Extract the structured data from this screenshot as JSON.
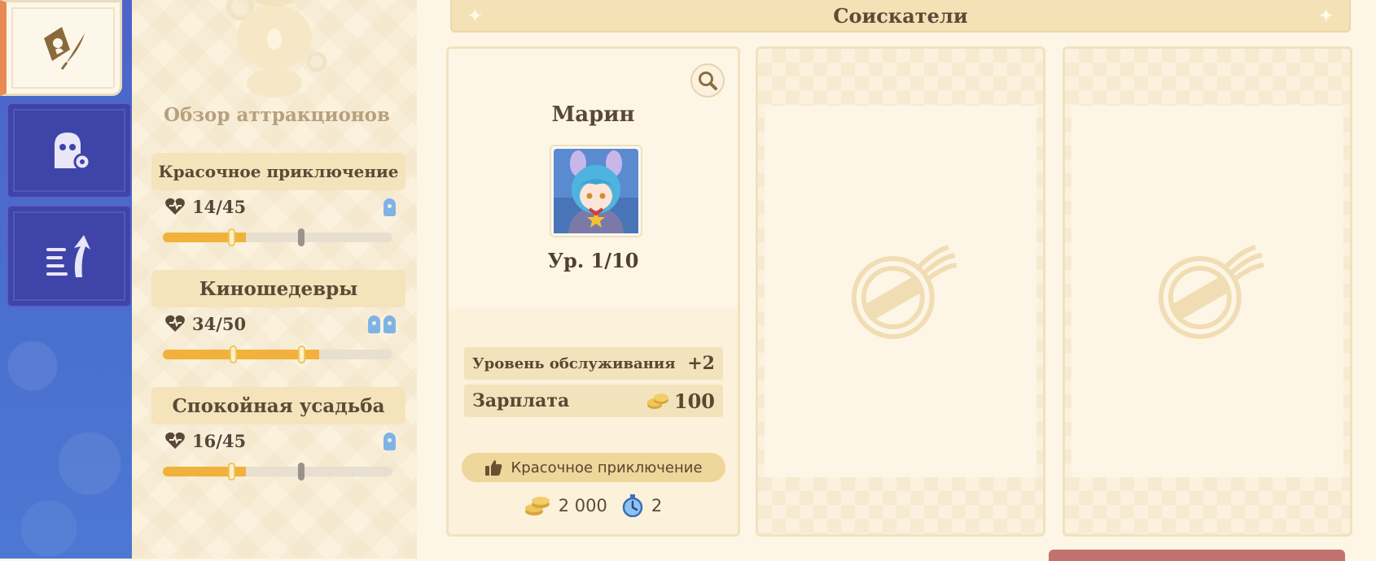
{
  "colors": {
    "accent": "#f1b13b",
    "rail": "#4d63c9",
    "panel": "#fbf2de"
  },
  "rail": {
    "tabs": [
      {
        "name": "recruit-icon"
      },
      {
        "name": "staff-icon"
      },
      {
        "name": "upgrade-icon"
      }
    ]
  },
  "overview": {
    "title": "Обзор аттракционов",
    "attractions": [
      {
        "name": "Красочное приключение",
        "stamina": "14/45",
        "ghosts": 1,
        "fill": 0.36,
        "marks": [
          0.29,
          0.6
        ]
      },
      {
        "name": "Киношедевры",
        "stamina": "34/50",
        "ghosts": 2,
        "fill": 0.68,
        "marks": [
          0.3,
          0.6
        ]
      },
      {
        "name": "Спокойная усадьба",
        "stamina": "16/45",
        "ghosts": 1,
        "fill": 0.36,
        "marks": [
          0.29,
          0.6
        ]
      }
    ]
  },
  "header": {
    "title": "Соискатели"
  },
  "candidate": {
    "name": "Марин",
    "level": "Ур. 1/10",
    "service_label": "Уровень обслуживания",
    "service_value": "+2",
    "salary_label": "Зарплата",
    "salary_value": "100",
    "preference": "Красочное приключение",
    "cost": "2 000",
    "time": "2"
  }
}
